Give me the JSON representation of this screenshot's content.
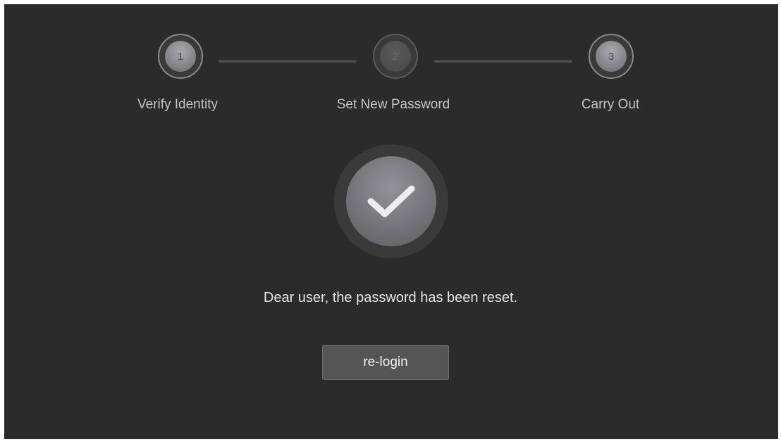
{
  "stepper": {
    "steps": [
      {
        "number": "1",
        "label": "Verify Identity",
        "state": "done"
      },
      {
        "number": "2",
        "label": "Set New Password",
        "state": "pending"
      },
      {
        "number": "3",
        "label": "Carry Out",
        "state": "done"
      }
    ]
  },
  "result": {
    "icon": "checkmark-icon",
    "message": "Dear user, the password has been reset."
  },
  "actions": {
    "relogin_label": "re-login"
  },
  "colors": {
    "background": "#2b2b2b",
    "button": "#555555",
    "text": "#e6e6e6"
  }
}
